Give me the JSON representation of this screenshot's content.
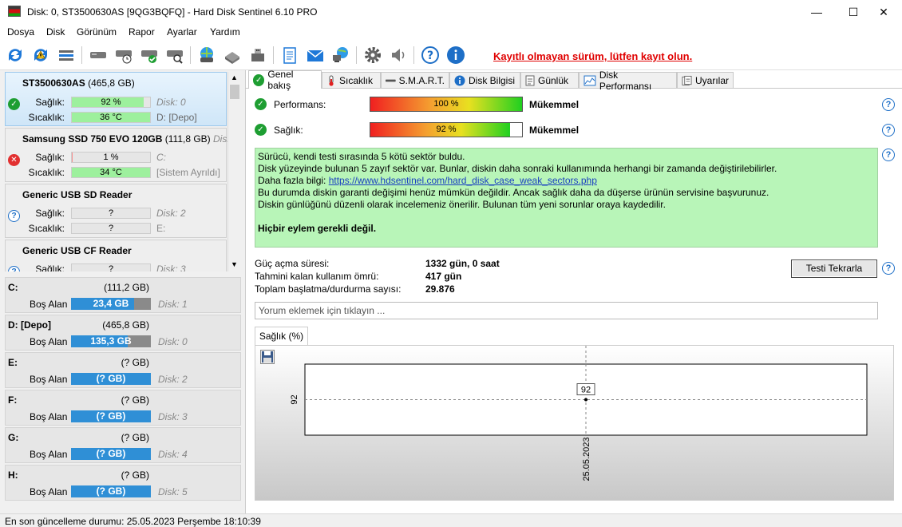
{
  "window": {
    "title": "Disk: 0, ST3500630AS [9QG3BQFQ]  -  Hard Disk Sentinel 6.10 PRO",
    "minimize": "—",
    "maximize": "☐",
    "close": "✕"
  },
  "menu": [
    "Dosya",
    "Disk",
    "Görünüm",
    "Rapor",
    "Ayarlar",
    "Yardım"
  ],
  "toolbar": {
    "icons": [
      "refresh-icon",
      "refresh-warning-icon",
      "disk-list-icon",
      "disk-icon",
      "disk-clock-icon",
      "disk-check-icon",
      "disk-search-icon",
      "network-disk-icon",
      "usb-icon",
      "usb-drive-icon",
      "notepad-icon",
      "mail-icon",
      "network-icon",
      "settings-icon",
      "speaker-icon",
      "help-icon",
      "info-icon"
    ],
    "registration_text": "Kayıtlı olmayan sürüm, lütfen kayıt olun."
  },
  "colors": {
    "accent": "#1e6fc7",
    "health_ok": "#9df09d",
    "health_bad": "#f89090",
    "message_bg": "#b8f5b8",
    "warning_red": "#e00000"
  },
  "disks": [
    {
      "name": "ST3500630AS",
      "size": "(465,8 GB)",
      "health_label": "Sağlık:",
      "health": "92 %",
      "health_fraction": 0.92,
      "temp_label": "Sıcaklık:",
      "temp": "36 °C",
      "info1": "Disk: 0",
      "info2": "D: [Depo]",
      "status": "ok"
    },
    {
      "name": "Samsung SSD 750 EVO 120GB",
      "size": "(111,8 GB)",
      "extra": "Disk:",
      "health_label": "Sağlık:",
      "health": "1 %",
      "health_fraction": 0.01,
      "temp_label": "Sıcaklık:",
      "temp": "34 °C",
      "info1": "C:",
      "info2": "[Sistem Ayrıldı]",
      "status": "error"
    },
    {
      "name": "Generic USB SD Reader",
      "size": "",
      "health_label": "Sağlık:",
      "health": "?",
      "temp_label": "Sıcaklık:",
      "temp": "?",
      "info1": "Disk: 2",
      "info2": "E:",
      "status": "unknown"
    },
    {
      "name": "Generic USB CF Reader",
      "size": "",
      "health_label": "Sağlık:",
      "health": "?",
      "info1": "Disk: 3",
      "status": "unknown"
    }
  ],
  "partitions": [
    {
      "letter": "C:",
      "size": "(111,2 GB)",
      "free_label": "Boş Alan",
      "free": "23,4 GB",
      "free_fraction": 0.79,
      "disk": "Disk: 1"
    },
    {
      "letter": "D: [Depo]",
      "size": "(465,8 GB)",
      "free_label": "Boş Alan",
      "free": "135,3 GB",
      "free_fraction": 0.71,
      "disk": "Disk: 0"
    },
    {
      "letter": "E:",
      "size": "(? GB)",
      "free_label": "Boş Alan",
      "free": "(? GB)",
      "free_fraction": 1,
      "disk": "Disk: 2"
    },
    {
      "letter": "F:",
      "size": "(? GB)",
      "free_label": "Boş Alan",
      "free": "(? GB)",
      "free_fraction": 1,
      "disk": "Disk: 3"
    },
    {
      "letter": "G:",
      "size": "(? GB)",
      "free_label": "Boş Alan",
      "free": "(? GB)",
      "free_fraction": 1,
      "disk": "Disk: 4"
    },
    {
      "letter": "H:",
      "size": "(? GB)",
      "free_label": "Boş Alan",
      "free": "(? GB)",
      "free_fraction": 1,
      "disk": "Disk: 5"
    }
  ],
  "tabs": [
    {
      "label": "Genel bakış",
      "icon": "check-icon"
    },
    {
      "label": "Sıcaklık",
      "icon": "thermometer-icon"
    },
    {
      "label": "S.M.A.R.T.",
      "icon": "smart-icon"
    },
    {
      "label": "Disk Bilgisi",
      "icon": "info-icon"
    },
    {
      "label": "Günlük",
      "icon": "log-icon"
    },
    {
      "label": "Disk Performansı",
      "icon": "chart-icon"
    },
    {
      "label": "Uyarılar",
      "icon": "alerts-icon"
    }
  ],
  "overview": {
    "performance_label": "Performans:",
    "performance_value": "100 %",
    "performance_fraction": 1.0,
    "performance_rating": "Mükemmel",
    "health_label": "Sağlık:",
    "health_value": "92 %",
    "health_fraction": 0.92,
    "health_rating": "Mükemmel",
    "message": {
      "line1": "Sürücü, kendi testi sırasında 5 kötü sektör buldu.",
      "line2": "Disk yüzeyinde bulunan 5 zayıf sektör var. Bunlar, diskin daha sonraki kullanımında herhangi bir zamanda değiştirilebilirler.",
      "line3_prefix": "Daha fazla bilgi: ",
      "link": "https://www.hdsentinel.com/hard_disk_case_weak_sectors.php",
      "line4": "Bu durumda diskin garanti değişimi henüz mümkün değildir. Ancak sağlık daha da düşerse ürünün servisine başvurunuz.",
      "line5": "Diskin günlüğünü düzenli olarak incelemeniz önerilir. Bulunan tüm yeni sorunlar oraya kaydedilir.",
      "action": "Hiçbir eylem gerekli değil."
    },
    "power_on_label": "Güç açma süresi:",
    "power_on_value": "1332 gün, 0 saat",
    "lifetime_label": "Tahmini kalan kullanım ömrü:",
    "lifetime_value": "417 gün",
    "startstop_label": "Toplam başlatma/durdurma sayısı:",
    "startstop_value": "29.876",
    "retest_button": "Testi Tekrarla",
    "comment_placeholder": "Yorum eklemek için tıklayın ..."
  },
  "chart_data": {
    "type": "line",
    "tab_label": "Sağlık (%)",
    "x": [
      "25.05.2023"
    ],
    "series": [
      {
        "values": [
          92
        ]
      }
    ],
    "ytick": "92",
    "point_label": "92"
  },
  "status": {
    "text": "En son güncelleme durumu: 25.05.2023 Perşembe 18:10:39"
  }
}
